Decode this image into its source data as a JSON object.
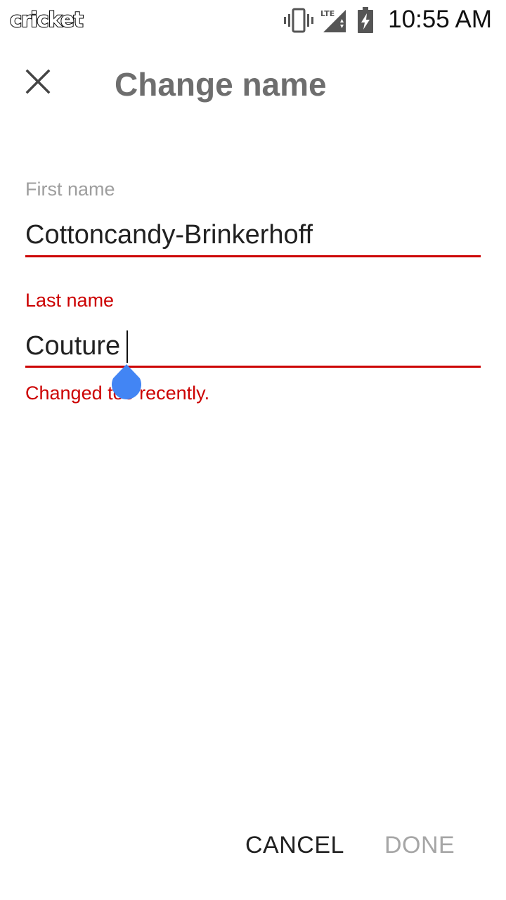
{
  "status_bar": {
    "carrier": "cricket",
    "time": "10:55 AM",
    "network_type": "LTE",
    "icons": [
      "vibrate-icon",
      "signal-icon",
      "battery-charging-icon"
    ]
  },
  "app_bar": {
    "close_icon": "close-icon",
    "title": "Change name"
  },
  "form": {
    "first_name": {
      "label": "First name",
      "value": "Cottoncandy-Brinkerhoff"
    },
    "last_name": {
      "label": "Last name",
      "value": "Couture",
      "error": "Changed too recently."
    }
  },
  "actions": {
    "cancel_label": "CANCEL",
    "done_label": "DONE"
  },
  "colors": {
    "accent_error": "#cc0000",
    "title_gray": "#6e6e6e",
    "label_gray": "#9e9e9e",
    "disabled_gray": "#a6a6a6",
    "cursor_handle_blue": "#4285f4"
  }
}
